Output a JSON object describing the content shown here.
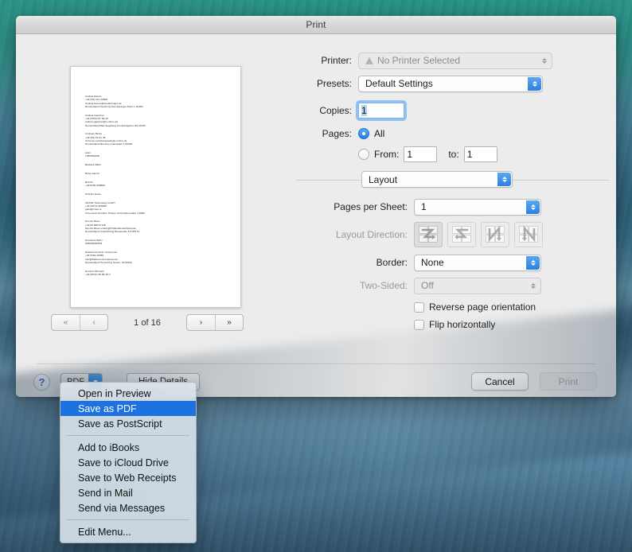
{
  "dialog": {
    "title": "Print"
  },
  "preview": {
    "nav": {
      "first_label": "«",
      "prev_label": "‹",
      "next_label": "›",
      "last_label": "»",
      "page_count_label": "1 of 16"
    },
    "document_blocks": [
      [
        "Andrea Deters",
        "+49 (40) 347-20800",
        "Andrea.Deters@axelspringer.de",
        "Deutschland Hamburg Axel-Springer-Platz 1 20350"
      ],
      [
        "Andrea Gaertner",
        "+49 (4551) 87 96 43",
        "andrea-gaertner@t-online.de",
        "Deutschland Bad Segeberg Am Apfelgarten 36 23795"
      ],
      [
        "Andreas Bonte",
        "+49 (89) 59 31 38",
        "dr.bonte-rechtsanwaelte@t-online.de",
        "Deutschland München Karlsplatz 4 80335"
      ],
      [
        "anon",
        "1380802008"
      ],
      [
        "Barbara Miller"
      ],
      [
        "Betty Garcia"
      ],
      [
        "Bolt Dr",
        "+49 8152 998860"
      ],
      [
        "Charles Davis"
      ],
      [
        "CRATE Technology GmbH",
        "+43 (5572) 908060",
        "jodel@crate.io",
        "Österreich Dornbirn Hintere Achmühlerstraße 1 6850"
      ],
      [
        "Dennis Breer",
        "+49 89 96010 130",
        "Dennis.Breer.extern@PKabelDeutschland.de",
        "Deutschland Unterföhring Betastraße 6-8 85774"
      ],
      [
        "Deutsche Bahn",
        "018050946503"
      ],
      [
        "Diabeteszentrum Ammersee",
        "+49 8152 29286",
        "info@diabetes-ammersee.de",
        "Deutschland Herrsching Seestr. 40 82211"
      ],
      [
        "Dominic Bönisch",
        "+49 (8031) 55 58 48 0"
      ]
    ]
  },
  "settings": {
    "printer": {
      "label": "Printer:",
      "value": "No Printer Selected",
      "has_warning_icon": true,
      "disabled": true
    },
    "presets": {
      "label": "Presets:",
      "value": "Default Settings",
      "disabled": false
    },
    "copies": {
      "label": "Copies:",
      "value": "1",
      "focused": true
    },
    "pages": {
      "label": "Pages:",
      "all_label": "All",
      "all_selected": true,
      "from_label": "From:",
      "from_value": "1",
      "to_label": "to:",
      "to_value": "1"
    },
    "pane_selector": {
      "value": "Layout"
    },
    "layout": {
      "pages_per_sheet": {
        "label": "Pages per Sheet:",
        "value": "1"
      },
      "layout_direction": {
        "label": "Layout Direction:",
        "disabled": true,
        "options": [
          "across-then-down-z",
          "across-then-down-reverse-s",
          "down-then-across-n",
          "down-then-across-reverse-n"
        ],
        "selected_index": 0
      },
      "border": {
        "label": "Border:",
        "value": "None"
      },
      "two_sided": {
        "label": "Two-Sided:",
        "value": "Off",
        "disabled": true
      },
      "reverse_page_orientation": {
        "label": "Reverse page orientation",
        "checked": false
      },
      "flip_horizontally": {
        "label": "Flip horizontally",
        "checked": false
      }
    }
  },
  "bottom_bar": {
    "help_label": "?",
    "pdf_label": "PDF",
    "hide_details_label": "Hide Details",
    "cancel_label": "Cancel",
    "print_label": "Print",
    "print_disabled": true
  },
  "pdf_menu": {
    "groups": [
      [
        {
          "label": "Open in Preview",
          "highlighted": false
        },
        {
          "label": "Save as PDF",
          "highlighted": true
        },
        {
          "label": "Save as PostScript",
          "highlighted": false
        }
      ],
      [
        {
          "label": "Add to iBooks",
          "highlighted": false
        },
        {
          "label": "Save to iCloud Drive",
          "highlighted": false
        },
        {
          "label": "Save to Web Receipts",
          "highlighted": false
        },
        {
          "label": "Send in Mail",
          "highlighted": false
        },
        {
          "label": "Send via Messages",
          "highlighted": false
        }
      ],
      [
        {
          "label": "Edit Menu...",
          "highlighted": false
        }
      ]
    ]
  },
  "colors": {
    "accent_blue": "#1e72e0",
    "popup_arrow_blue": "#2b7fe0",
    "dialog_bg": "#ececec",
    "help_blue": "#2f72d0"
  }
}
